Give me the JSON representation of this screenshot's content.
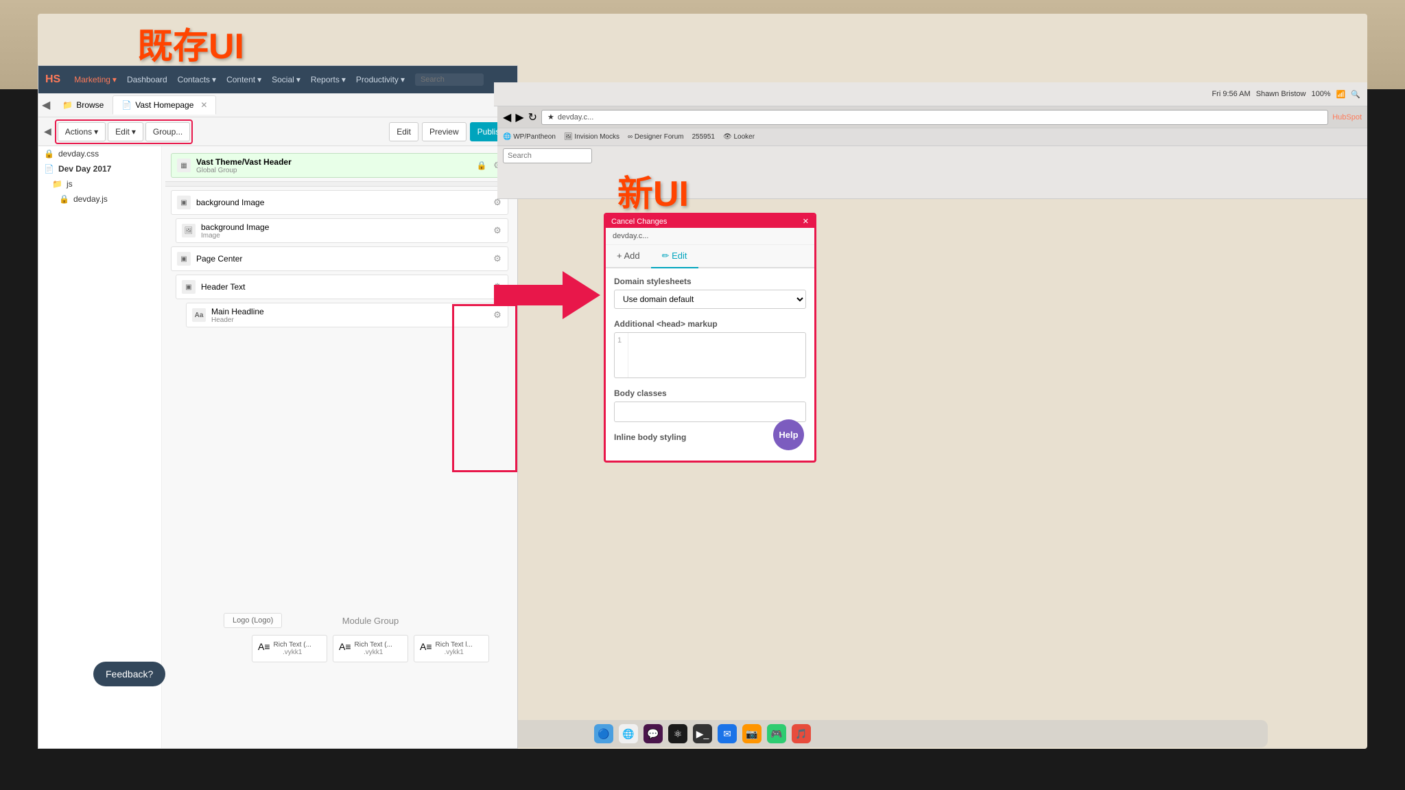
{
  "overlay": {
    "title_existing": "既存UI",
    "title_new": "新UI"
  },
  "mac_topbar": {
    "battery": "100%",
    "time": "Fri 9:56 AM",
    "user": "Shawn Bristow",
    "icons": [
      "wifi-icon",
      "battery-icon",
      "brightness-icon"
    ]
  },
  "browser": {
    "url": "devday.c...",
    "bookmarks": [
      "WP/Pantheon",
      "Invision Mocks",
      "Designer Forum",
      "255951",
      "Looker"
    ],
    "search_placeholder": "Search"
  },
  "hubspot_old": {
    "navbar": {
      "logo": "HS",
      "items": [
        "Marketing",
        "Dashboard",
        "Contacts",
        "Content",
        "Social",
        "Reports",
        "Productivity",
        "Search"
      ]
    },
    "tabs": [
      {
        "label": "Browse",
        "active": false
      },
      {
        "label": "Vast Homepage",
        "active": true
      }
    ],
    "toolbar": {
      "actions_label": "Actions",
      "edit_label": "Edit",
      "group_label": "Group...",
      "edit2_label": "Edit",
      "preview_label": "Preview",
      "publish_label": "Publish"
    },
    "modules": [
      {
        "name": "Vast Theme/Vast Header",
        "type": "Global Group",
        "icon": "grid-icon"
      },
      {
        "name": "background Image",
        "type": "group",
        "icon": "group-icon"
      },
      {
        "name": "background Image",
        "type": "Image",
        "icon": "image-icon"
      },
      {
        "name": "Page Center",
        "type": "group",
        "icon": "group-icon"
      },
      {
        "name": "Header Text",
        "type": "group",
        "icon": "group-icon"
      },
      {
        "name": "Main Headline",
        "type": "Header",
        "icon": "text-icon"
      }
    ],
    "sidebar_files": [
      {
        "name": "devday.css",
        "icon": "🔒",
        "type": "css"
      },
      {
        "name": "Dev Day 2017",
        "icon": "📄",
        "type": "folder"
      },
      {
        "name": "js",
        "icon": "📁",
        "type": "folder"
      },
      {
        "name": "devday.js",
        "icon": "🔒",
        "type": "js"
      }
    ],
    "bottom_modules": {
      "logo_label": "Logo (Logo)",
      "module_group_label": "Module Group",
      "rich_texts": [
        {
          "label": "Rich Text (....vykk1"
        },
        {
          "label": "Rich Text (....vykk1"
        },
        {
          "label": "Rich Text l....vykk1"
        }
      ]
    },
    "feedback_btn": "Feedback?"
  },
  "hubspot_new": {
    "header_label": "Cancel Changes",
    "tabs": [
      {
        "label": "+ Add",
        "active": false
      },
      {
        "label": "✏ Edit",
        "active": true
      }
    ],
    "url_field": "devday.c...",
    "fields": [
      {
        "label": "Domain stylesheets",
        "type": "select",
        "value": "Use domain default"
      },
      {
        "label": "Additional <head> markup",
        "type": "textarea",
        "line_number": "1",
        "value": ""
      },
      {
        "label": "Body classes",
        "type": "input",
        "value": ""
      },
      {
        "label": "Inline body styling",
        "type": "input",
        "value": ""
      }
    ],
    "help_btn": "Help"
  },
  "arrow": {
    "direction": "right",
    "color": "#e8174a"
  },
  "dock": {
    "icons": [
      "finder-icon",
      "chrome-icon",
      "slack-icon",
      "atom-icon",
      "terminal-icon",
      "mail-icon"
    ]
  }
}
